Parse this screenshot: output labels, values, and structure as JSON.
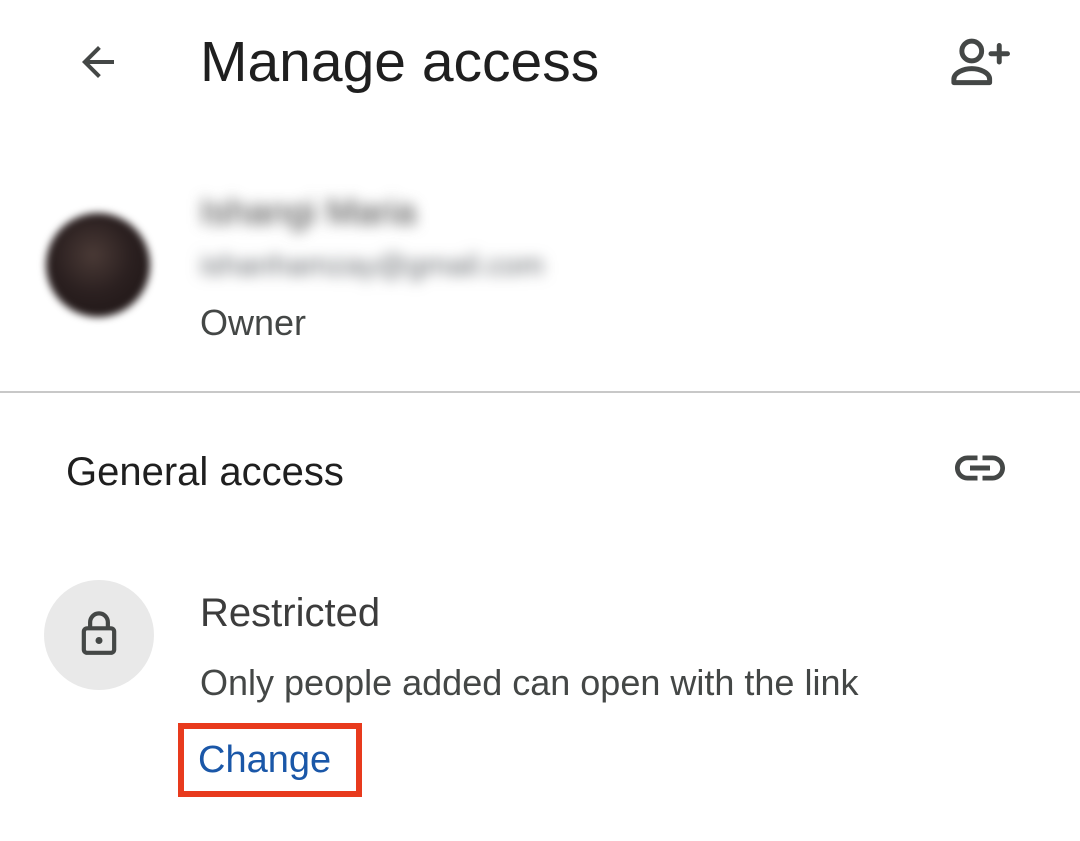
{
  "header": {
    "title": "Manage access",
    "back_icon": "arrow-back-icon",
    "add_people_icon": "person-add-icon"
  },
  "owner": {
    "name": "Ishangi Maria",
    "email": "ishanhamzay@gmail.com",
    "role": "Owner",
    "avatar_icon": "avatar"
  },
  "general_access": {
    "title": "General access",
    "link_icon": "link-icon",
    "lock_icon": "lock-icon",
    "level": "Restricted",
    "description": "Only people added can open with the link",
    "change_label": "Change"
  },
  "colors": {
    "text_primary": "#1f1f1f",
    "text_secondary": "#444746",
    "link_blue": "#1a57a8",
    "highlight_red": "#e83a1d",
    "lock_circle_bg": "#e9e9e9",
    "divider": "#c8c8c8"
  }
}
